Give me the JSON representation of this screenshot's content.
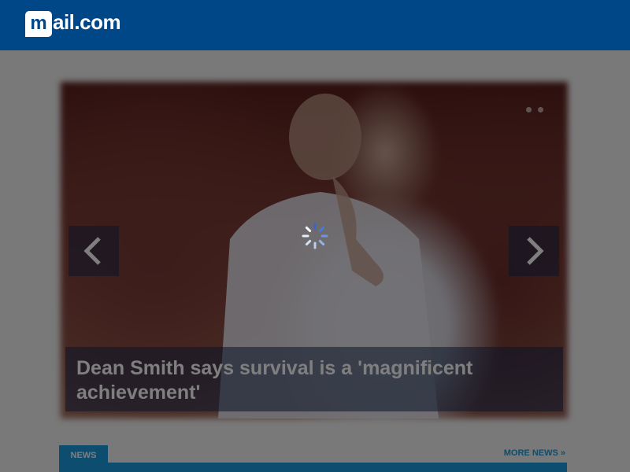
{
  "header": {
    "logo_mark": "m",
    "logo_text": "ail.com",
    "brand_color": "#004788"
  },
  "slider": {
    "caption": "Dean Smith says survival is a 'magnificent achievement'",
    "prev_icon": "chevron-left-icon",
    "next_icon": "chevron-right-icon"
  },
  "section": {
    "tab_label": "NEWS",
    "more_label": "MORE NEWS »",
    "accent_color": "#1a9ae0"
  },
  "loading": {
    "icon": "spinner-icon",
    "overlay_color": "rgba(0,0,0,0.5)"
  }
}
